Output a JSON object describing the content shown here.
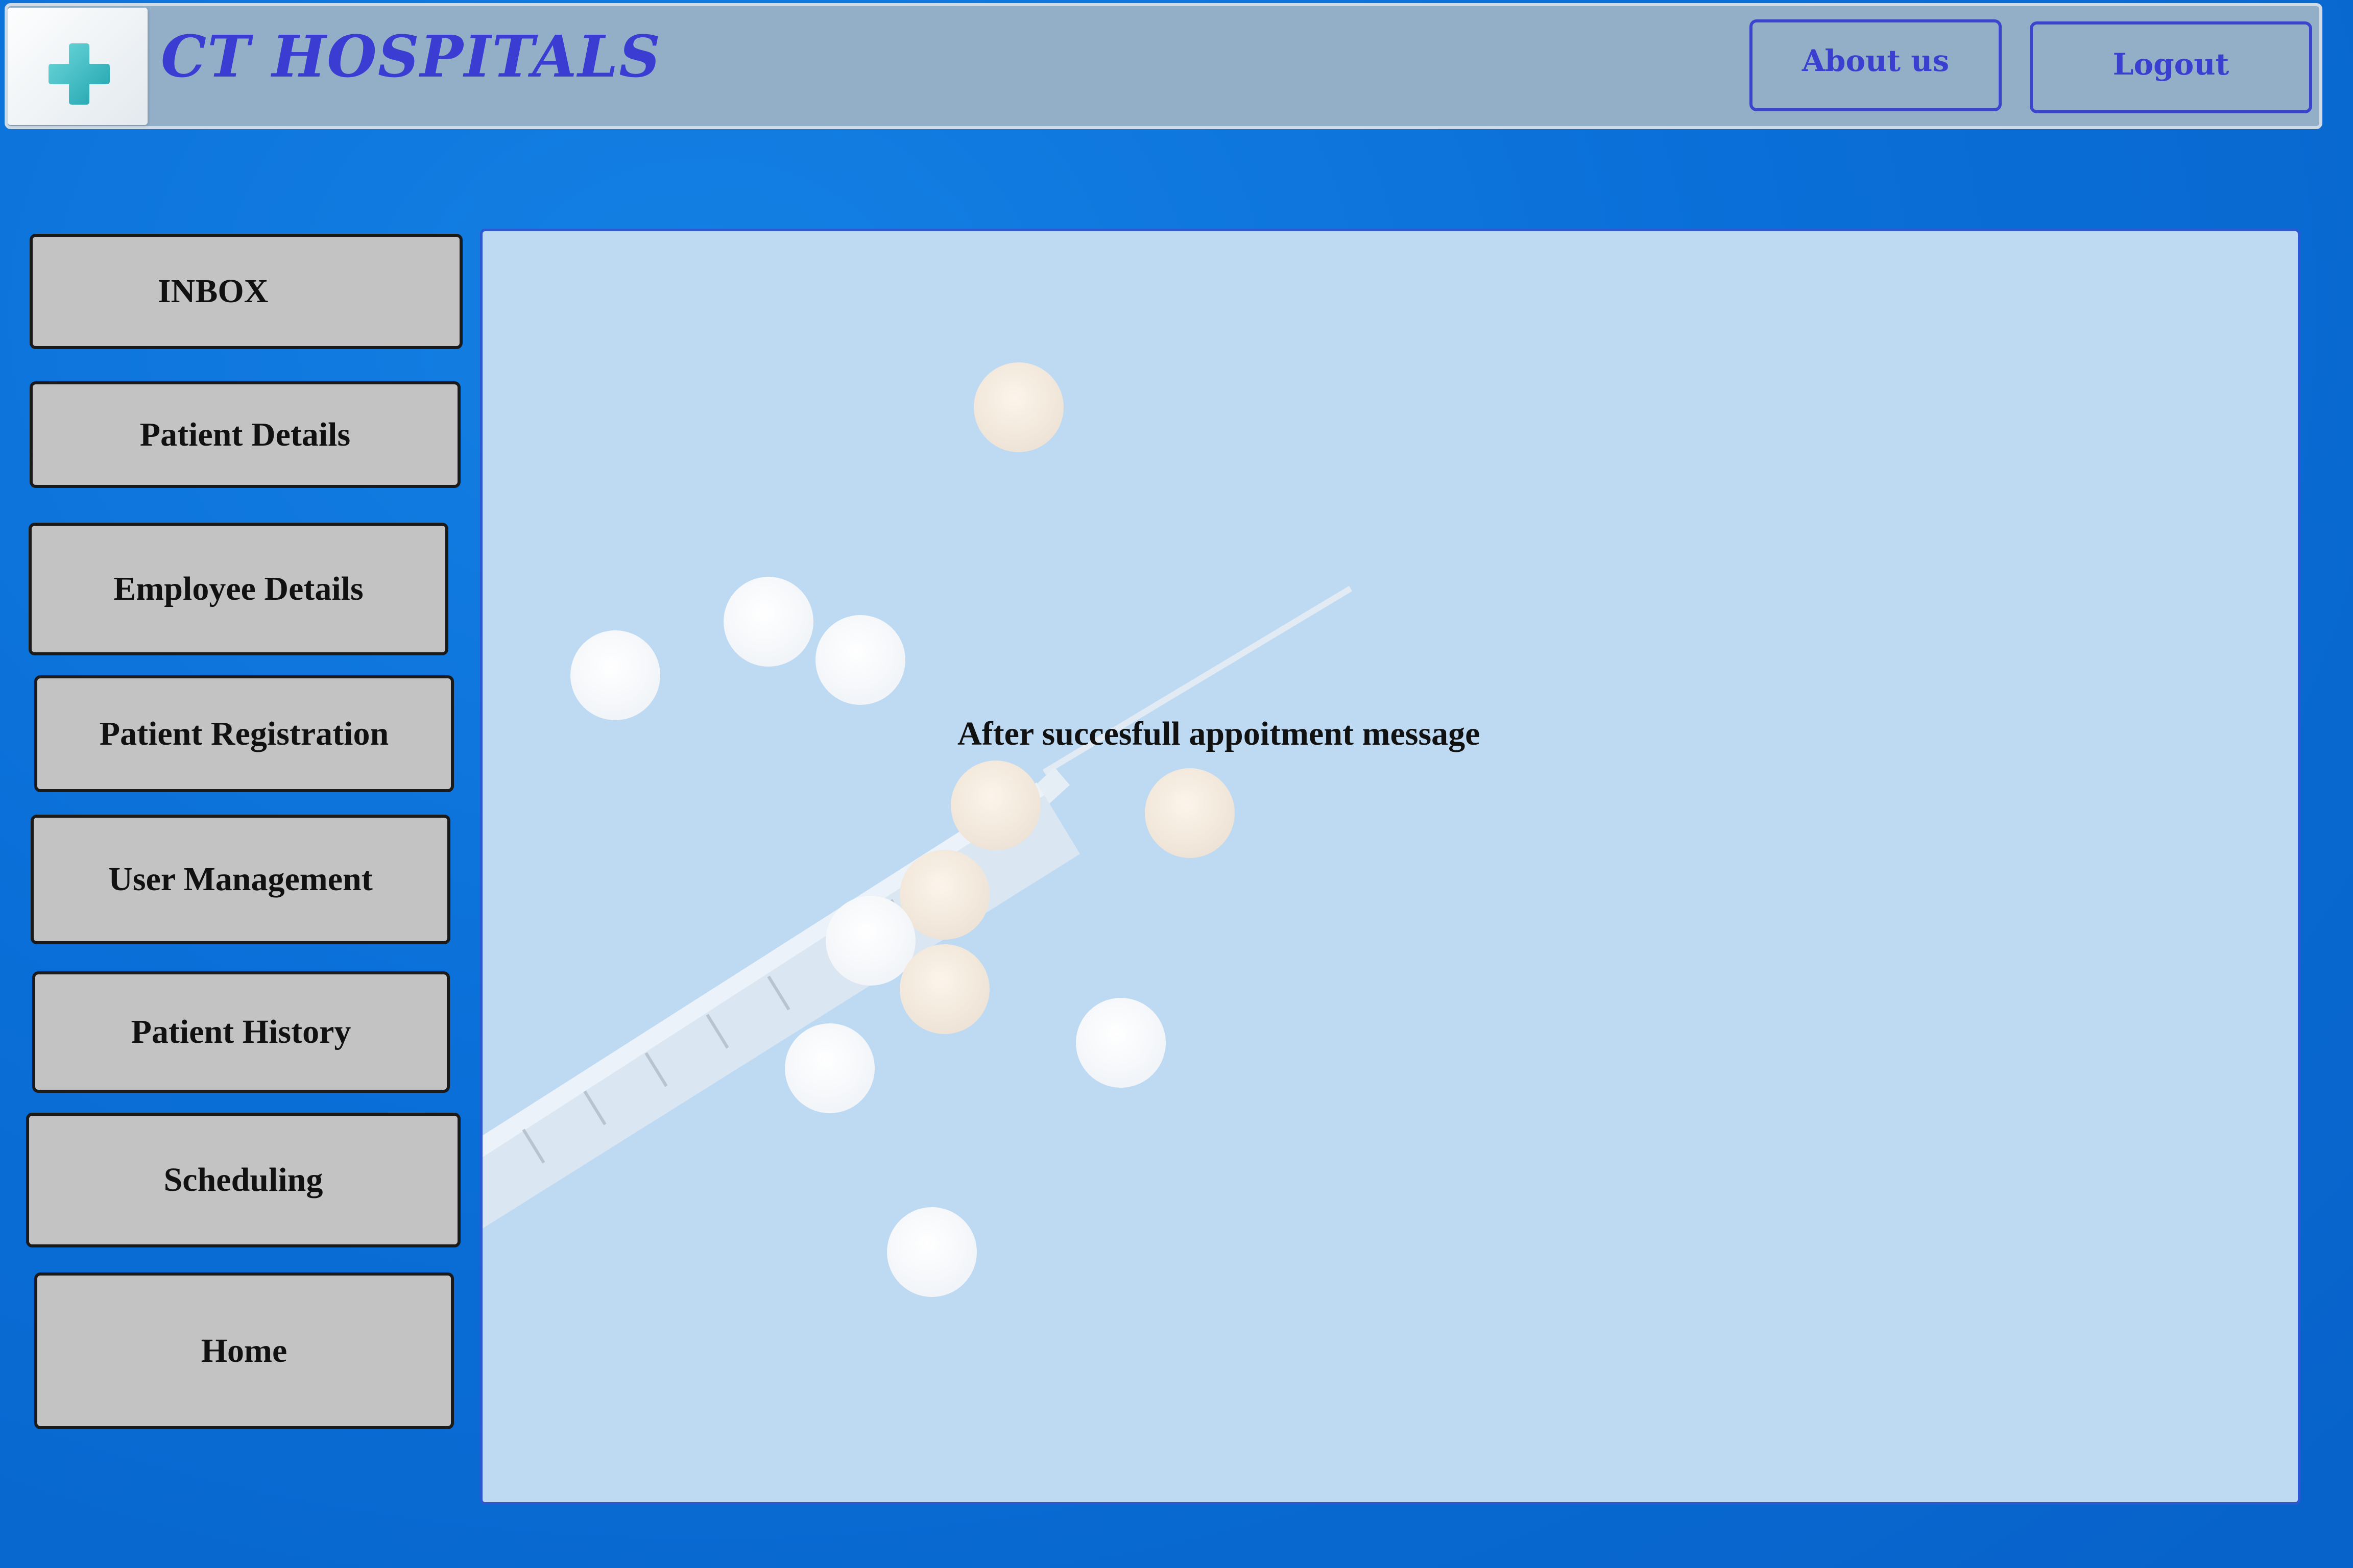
{
  "header": {
    "logo_icon": "medical-cross-icon",
    "brand": "CT HOSPITALS",
    "about_label": "About us",
    "logout_label": "Logout"
  },
  "sidebar": {
    "items": [
      {
        "label": "INBOX"
      },
      {
        "label": "Patient Details"
      },
      {
        "label": "Employee Details"
      },
      {
        "label": "Patient Registration"
      },
      {
        "label": "User Management"
      },
      {
        "label": "Patient History"
      },
      {
        "label": "Scheduling"
      },
      {
        "label": "Home"
      }
    ]
  },
  "main": {
    "message": "After succesfull appoitment message"
  },
  "colors": {
    "background": "#0a6fd8",
    "header": "#93afc8",
    "brand_text": "#3a3cd2",
    "nav_button": "#c3c3c3",
    "panel": "#bedaf3",
    "logo_cross": "#3fc1c9"
  }
}
